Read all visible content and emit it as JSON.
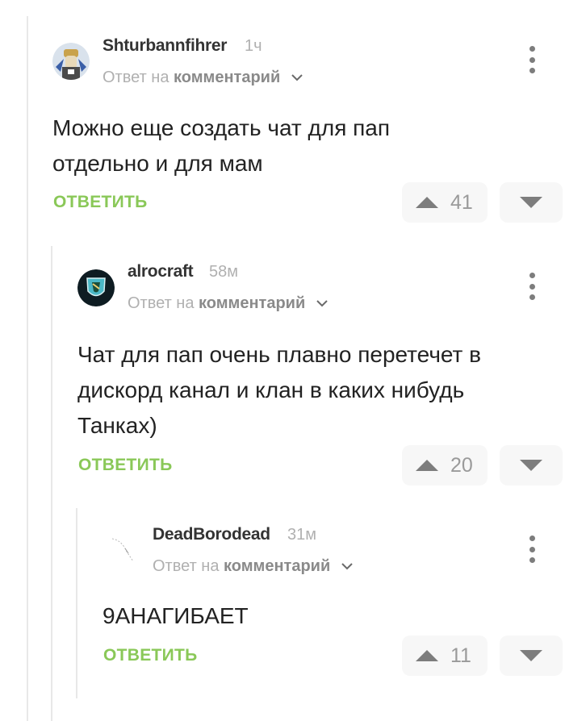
{
  "comments": [
    {
      "author": "Shturbannfihrer",
      "time": "1ч",
      "reply_prefix": "Ответ на",
      "reply_target": "комментарий",
      "text_lines": [
        "Можно еще создать чат для пап",
        "отдельно и для мам"
      ],
      "reply_label": "ОТВЕТИТЬ",
      "score": "41"
    },
    {
      "author": "alrocraft",
      "time": "58м",
      "reply_prefix": "Ответ на",
      "reply_target": "комментарий",
      "text_lines": [
        "Чат для пап очень плавно перетечет в",
        "дискорд канал и клан в каких нибудь",
        "Танках)"
      ],
      "reply_label": "ОТВЕТИТЬ",
      "score": "20"
    },
    {
      "author": "DeadBorodead",
      "time": "31м",
      "reply_prefix": "Ответ на",
      "reply_target": "комментарий",
      "text_lines": [
        "9АНАГИБАЕТ"
      ],
      "reply_label": "ОТВЕТИТЬ",
      "score": "11"
    }
  ],
  "icons": {
    "upvote": "triangle-up-icon",
    "downvote": "triangle-down-icon",
    "menu": "vertical-dots-icon",
    "chevron": "chevron-down-icon"
  },
  "colors": {
    "reply_green": "#8ac858",
    "vote_bg": "#f7f7f7",
    "icon_gray": "#7d7d7d",
    "muted_text": "#b0b0b0"
  }
}
